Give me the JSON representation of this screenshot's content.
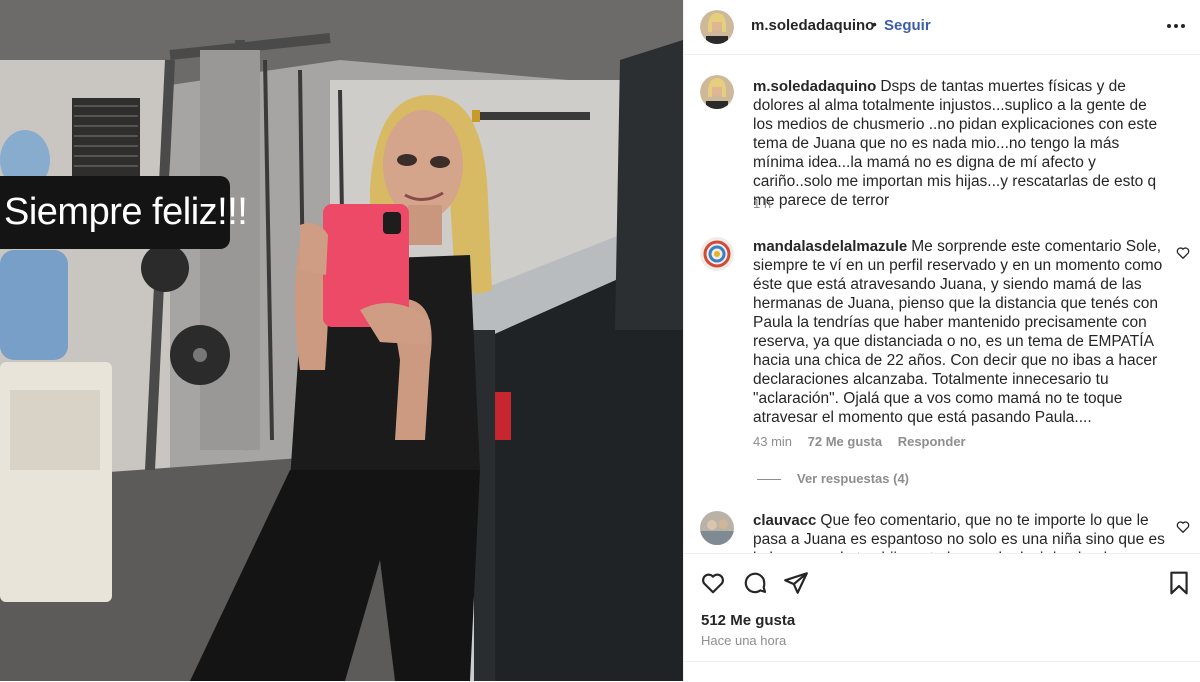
{
  "photo": {
    "sticker_text": "Siempre feliz!!!"
  },
  "header": {
    "username": "m.soledadaquino",
    "dot": "•",
    "follow_label": "Seguir",
    "more_icon": "more-horizontal-icon"
  },
  "caption": {
    "username": "m.soledadaquino",
    "text": "Dsps de tantas muertes físicas y de dolores al alma totalmente injustos...suplico a la gente de los medios de chusmerio ..no pidan explicaciones con este tema de Juana que no es nada mio...no tengo la más mínima idea...la mamá no es digna de mí afecto y cariño..solo me importan mis hijas...y rescatarlas de esto q me parece de terror",
    "time": "1 h"
  },
  "comments": [
    {
      "username": "mandalasdelalmazule",
      "text": "Me sorprende este comentario Sole, siempre te ví en un perfil reservado y en un momento como éste que está atravesando Juana, y siendo mamá de las hermanas de Juana, pienso que la distancia que tenés con Paula la tendrías que haber mantenido precisamente con reserva, ya que distanciada o no, es un tema de EMPATÍA hacia una chica de 22 años. Con decir que no ibas a hacer declaraciones alcanzaba. Totalmente innecesario tu \"aclaración\". Ojalá que a vos como mamá no te toque atravesar el momento que está pasando Paula....",
      "time": "43 min",
      "likes": "72 Me gusta",
      "reply_label": "Responder",
      "view_replies": "Ver respuestas (4)"
    },
    {
      "username": "clauvacc",
      "text": "Que feo comentario, que no te importe lo que le pasa a Juana es espantoso no solo es una niña sino que es la hermana de tus hijas y te lo manda decir la abuela"
    }
  ],
  "actions": {
    "like_icon": "heart-icon",
    "comment_icon": "comment-icon",
    "share_icon": "share-icon",
    "save_icon": "bookmark-icon",
    "likes": "512 Me gusta",
    "time": "Hace una hora"
  },
  "colors": {
    "follow": "#3d5fa8",
    "muted": "#8e8e8e",
    "text": "#262626",
    "phone_case": "#ec4a67"
  }
}
